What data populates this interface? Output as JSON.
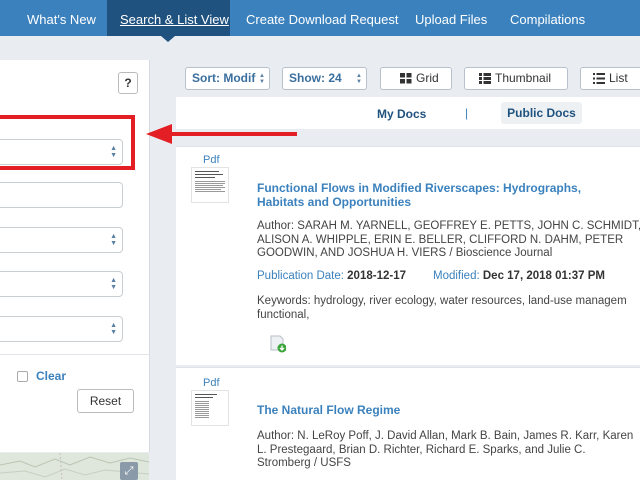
{
  "nav": {
    "items": [
      {
        "label": "What's New",
        "active": false
      },
      {
        "label": "Search & List View",
        "active": true
      },
      {
        "label": "Create Download Request",
        "active": false
      },
      {
        "label": "Upload Files",
        "active": false
      },
      {
        "label": "Compilations",
        "active": false
      }
    ]
  },
  "filters": {
    "help_label": "?",
    "clear_label": "Clear",
    "reset_label": "Reset"
  },
  "toolbar": {
    "sort_label": "Sort: Modif",
    "show_label": "Show: 24",
    "grid_label": "Grid",
    "thumbnail_label": "Thumbnail",
    "list_label": "List"
  },
  "tabs": {
    "my_docs": "My Docs",
    "separator": "|",
    "public_docs": "Public Docs"
  },
  "results": [
    {
      "type": "Pdf",
      "title_line1": "Functional Flows in Modified Riverscapes: Hydrographs,",
      "title_line2": "Habitats and Opportunities",
      "author_line1": "Author: SARAH M. YARNELL, GEOFFREY E. PETTS, JOHN C. SCHMIDT,",
      "author_line2": "ALISON A. WHIPPLE, ERIN E. BELLER, CLIFFORD N. DAHM, PETER",
      "author_line3": "GOODWIN, AND JOSHUA H. VIERS / Bioscience Journal",
      "pub_label": "Publication Date:",
      "pub_value": "2018-12-17",
      "mod_label": "Modified:",
      "mod_value": "Dec 17, 2018 01:37 PM",
      "keywords_line1": "Keywords: hydrology, river ecology, water resources, land-use managem",
      "keywords_line2": "functional,"
    },
    {
      "type": "Pdf",
      "title_line1": "The Natural Flow Regime",
      "author_line1": "Author: N. LeRoy Poff, J. David Allan, Mark B. Bain, James R. Karr, Karen",
      "author_line2": "L. Prestegaard, Brian D. Richter, Richard E. Sparks, and Julie C.",
      "author_line3": "Stromberg / USFS"
    }
  ],
  "colors": {
    "nav_bg": "#3b81bd",
    "nav_active": "#20527f",
    "link": "#3b81bd",
    "highlight": "#e31e24"
  },
  "icons": {
    "grid": "grid-icon",
    "thumbnail": "thumbnail-list-icon",
    "list": "list-icon",
    "download": "download-file-icon",
    "expand": "expand-icon"
  }
}
